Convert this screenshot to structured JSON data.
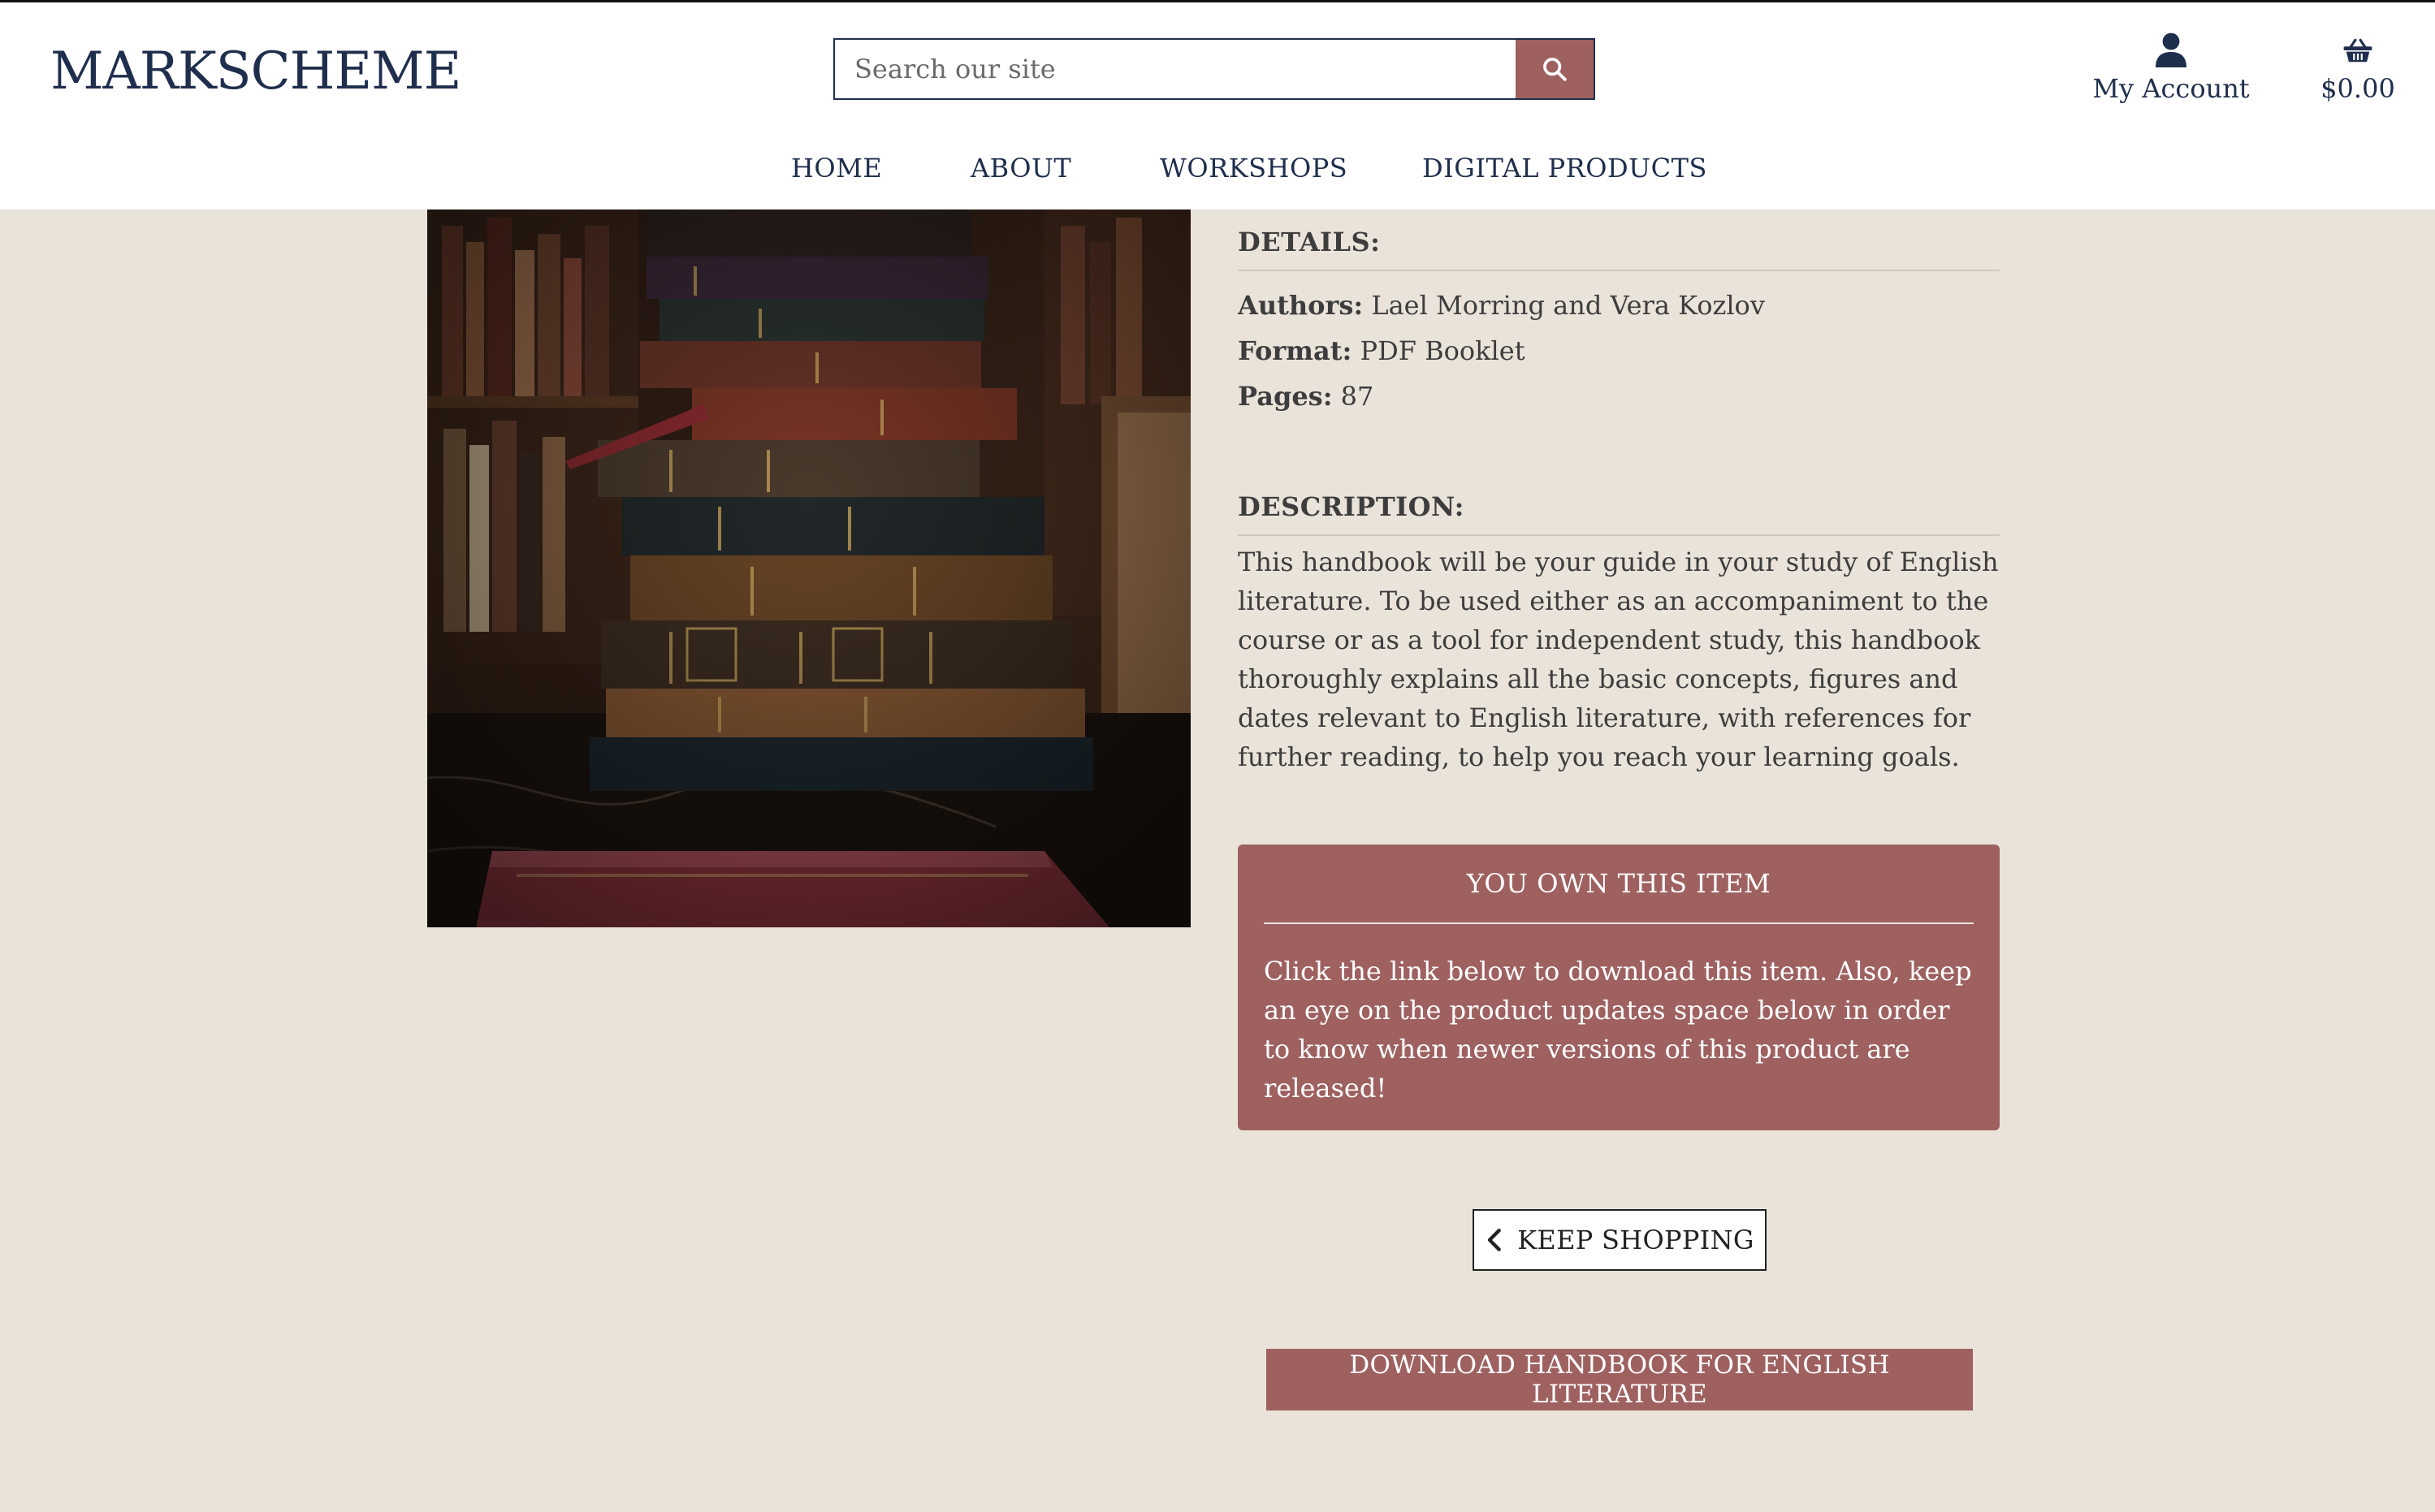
{
  "header": {
    "logo": "MARKSCHEME",
    "search": {
      "placeholder": "Search our site",
      "value": ""
    },
    "account_label": "My Account",
    "cart_total": "$0.00"
  },
  "nav": {
    "items": [
      {
        "label": "HOME"
      },
      {
        "label": "ABOUT"
      },
      {
        "label": "WORKSHOPS"
      },
      {
        "label": "DIGITAL PRODUCTS"
      }
    ]
  },
  "product": {
    "details_heading": "DETAILS:",
    "authors_label": "Authors:",
    "authors": "Lael Morring and Vera Kozlov",
    "format_label": "Format:",
    "format": "PDF Booklet",
    "pages_label": "Pages:",
    "pages": "87",
    "description_heading": "DESCRIPTION:",
    "description": "This handbook will be your guide in your study of English literature. To be used either as an accompaniment to the course or as a tool for independent study, this handbook thoroughly explains all the basic concepts, figures and dates relevant to English literature, with references for further reading, to help you reach your learning goals."
  },
  "ownership": {
    "title": "YOU OWN THIS ITEM",
    "message": "Click the link below to download this item. Also, keep an eye on the product updates space below in order to know when newer versions of this product are released!"
  },
  "actions": {
    "keep_shopping": "KEEP SHOPPING",
    "download": "DOWNLOAD HANDBOOK FOR ENGLISH LITERATURE"
  },
  "colors": {
    "accent": "#9E6160",
    "navy": "#1F2E4D",
    "page_background": "#EAE3DA",
    "header_background": "#FFFFFF"
  },
  "icons": {
    "search": "search-icon",
    "account": "user-icon",
    "cart": "basket-icon",
    "back": "chevron-left-icon"
  }
}
